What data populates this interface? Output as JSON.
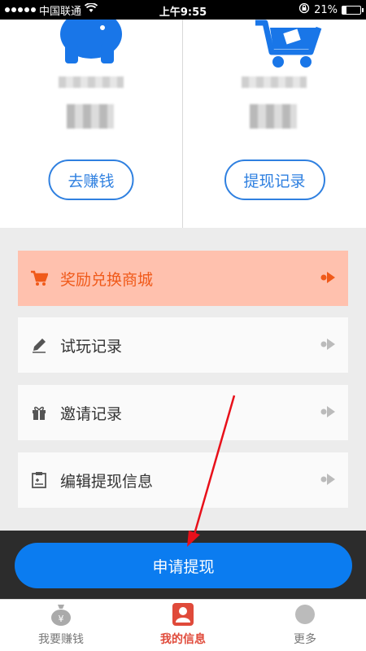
{
  "status_bar": {
    "carrier": "中国联通",
    "time": "上午9:55",
    "battery": "21%",
    "battery_level": 0.21
  },
  "cards": [
    {
      "icon": "piggy-bank-icon",
      "button_label": "去赚钱"
    },
    {
      "icon": "shopping-cart-icon",
      "button_label": "提现记录"
    }
  ],
  "menu": {
    "items": [
      {
        "label": "奖励兑换商城",
        "icon": "cart-icon"
      },
      {
        "label": "试玩记录",
        "icon": "pencil-icon"
      },
      {
        "label": "邀请记录",
        "icon": "gift-icon"
      },
      {
        "label": "编辑提现信息",
        "icon": "clipboard-icon"
      }
    ]
  },
  "apply_button": "申请提现",
  "tabs": [
    {
      "label": "我要赚钱",
      "icon": "money-bag-icon"
    },
    {
      "label": "我的信息",
      "icon": "user-profile-icon"
    },
    {
      "label": "更多",
      "icon": "more-icon"
    }
  ],
  "colors": {
    "primary": "#0b7cf0",
    "accent_orange": "#f05a1a",
    "highlight_bg": "#ffc1ae",
    "tab_active": "#e04a3a"
  }
}
